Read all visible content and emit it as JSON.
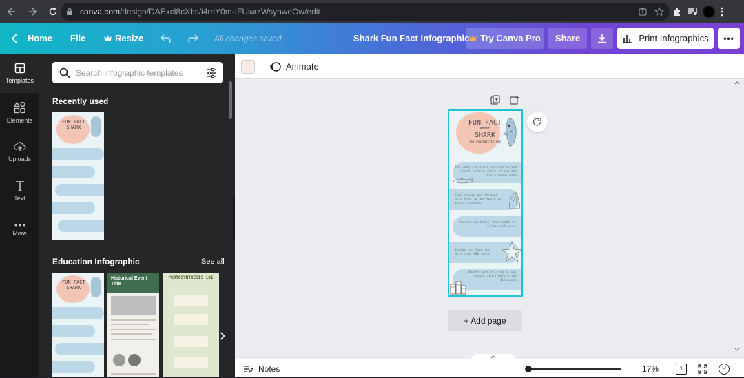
{
  "browser": {
    "url_host": "canva.com",
    "url_path": "/design/DAExcl8cXbs/i4rnY0m-IFUwrzWsyhweOw/edit"
  },
  "header": {
    "home": "Home",
    "file": "File",
    "resize": "Resize",
    "saved_status": "All changes saved",
    "design_title": "Shark Fun Fact Infographic",
    "try_pro": "Try Canva Pro",
    "share": "Share",
    "print": "Print Infographics",
    "more": "•••"
  },
  "rail": {
    "items": [
      {
        "label": "Templates",
        "icon": "layout-icon"
      },
      {
        "label": "Elements",
        "icon": "shapes-icon"
      },
      {
        "label": "Uploads",
        "icon": "cloud-upload-icon"
      },
      {
        "label": "Text",
        "icon": "text-icon"
      },
      {
        "label": "More",
        "icon": "dots-icon"
      }
    ]
  },
  "panel": {
    "search_placeholder": "Search infographic templates",
    "recently_used": "Recently used",
    "education_title": "Education Infographic",
    "see_all": "See all",
    "templates": [
      {
        "title": "Historical Event Title"
      },
      {
        "title": "PHOTOSYNTHESIS 101"
      }
    ]
  },
  "editor": {
    "animate": "Animate",
    "add_page": "+ Add page",
    "notes": "Notes",
    "zoom": "17%",
    "page_count": "1",
    "help": "?"
  },
  "design": {
    "title_line1": "FUN FACT",
    "title_about": "about",
    "title_line2": "SHARK",
    "site": "reallygreatsite.com",
    "facts": [
      "The smallest shark species called dwarf lantern shark is smaller than a human hand",
      "Some sharks get through more than 20,000 teeth in their lifetimes",
      "Sharks can travel thousands of miles each year",
      "Sharks can live for more than 400 years",
      "Sharks have existed in our oceans since before the dinosaurs"
    ]
  },
  "colors": {
    "accent": "#1fc3d4",
    "blob_blue": "#bcd8e6",
    "blob_pink": "#f3c5b4"
  }
}
